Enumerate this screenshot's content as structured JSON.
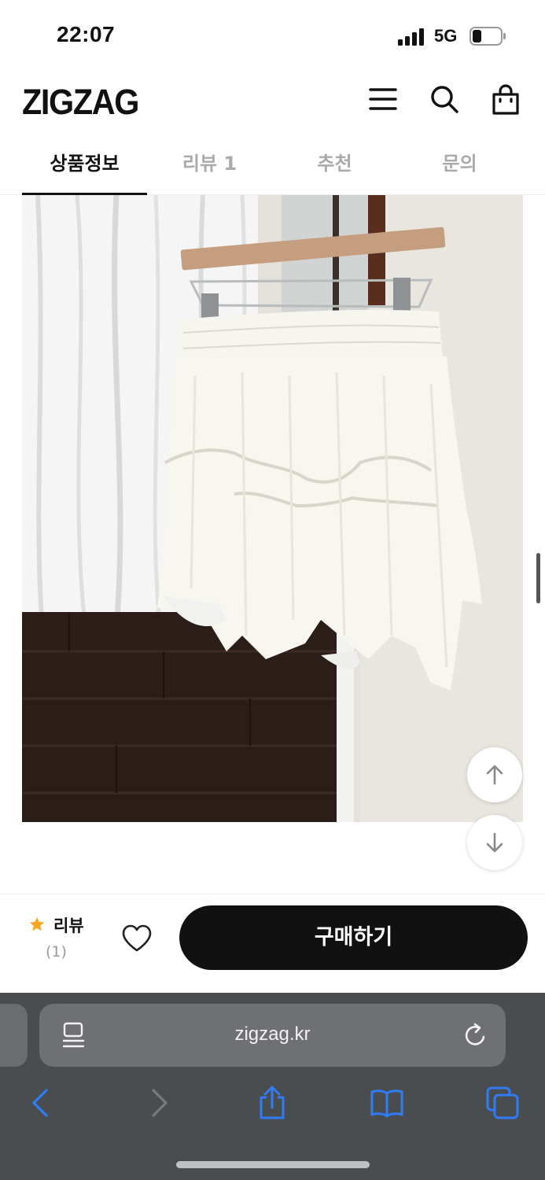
{
  "status_bar": {
    "time": "22:07",
    "network": "5G",
    "battery_level": 0.25
  },
  "header": {
    "logo": "ZIGZAG",
    "icons": [
      "menu-icon",
      "search-icon",
      "shopping-bag-icon"
    ]
  },
  "tabs": [
    {
      "label": "상품정보",
      "active": true
    },
    {
      "label": "리뷰 1",
      "active": false
    },
    {
      "label": "추천",
      "active": false
    },
    {
      "label": "문의",
      "active": false
    }
  ],
  "scroll_buttons": {
    "up_icon": "arrow-up-icon",
    "down_icon": "arrow-down-icon"
  },
  "purchase_bar": {
    "review_label": "리뷰",
    "review_count": "(1)",
    "wishlist_icon": "heart-icon",
    "buy_label": "구매하기",
    "star_color": "#f5a623"
  },
  "browser": {
    "url": "zigzag.kr",
    "icons": [
      "reader-mode-icon",
      "reload-icon",
      "back-icon",
      "forward-icon",
      "share-icon",
      "bookmarks-icon",
      "tabs-icon"
    ],
    "accent_color": "#2f7cf6"
  }
}
